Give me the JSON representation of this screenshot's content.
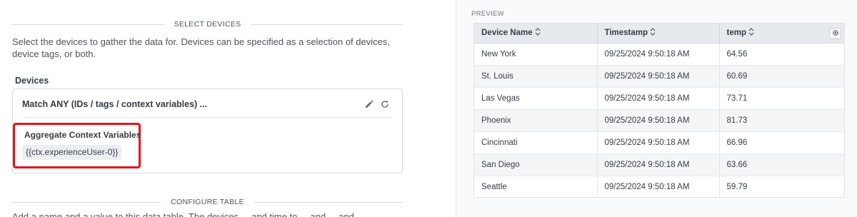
{
  "left": {
    "select_devices_title": "SELECT DEVICES",
    "description": "Select the devices to gather the data for. Devices can be specified as a selection of devices, device tags, or both.",
    "devices_label": "Devices",
    "match_header": "Match ANY (IDs / tags / context variables) ...",
    "aggregate_label": "Aggregate Context Variables",
    "context_tag": "{{ctx.experienceUser-0}}",
    "configure_table_title": "CONFIGURE TABLE",
    "cut_off_text": "Add a name and a value to this data table. The devices ... and time to ... and ... and ..."
  },
  "preview": {
    "label": "PREVIEW",
    "columns": [
      "Device Name",
      "Timestamp",
      "temp"
    ],
    "rows": [
      [
        "New York",
        "09/25/2024 9:50:18 AM",
        "64.56"
      ],
      [
        "St. Louis",
        "09/25/2024 9:50:18 AM",
        "60.69"
      ],
      [
        "Las Vegas",
        "09/25/2024 9:50:18 AM",
        "73.71"
      ],
      [
        "Phoenix",
        "09/25/2024 9:50:18 AM",
        "81.73"
      ],
      [
        "Cincinnati",
        "09/25/2024 9:50:18 AM",
        "66.96"
      ],
      [
        "San Diego",
        "09/25/2024 9:50:18 AM",
        "63.66"
      ],
      [
        "Seattle",
        "09/25/2024 9:50:18 AM",
        "59.79"
      ],
      [
        "",
        "",
        ""
      ]
    ]
  },
  "colors": {
    "highlight_border": "#e4141b",
    "header_bg": "#e6e9ed"
  }
}
